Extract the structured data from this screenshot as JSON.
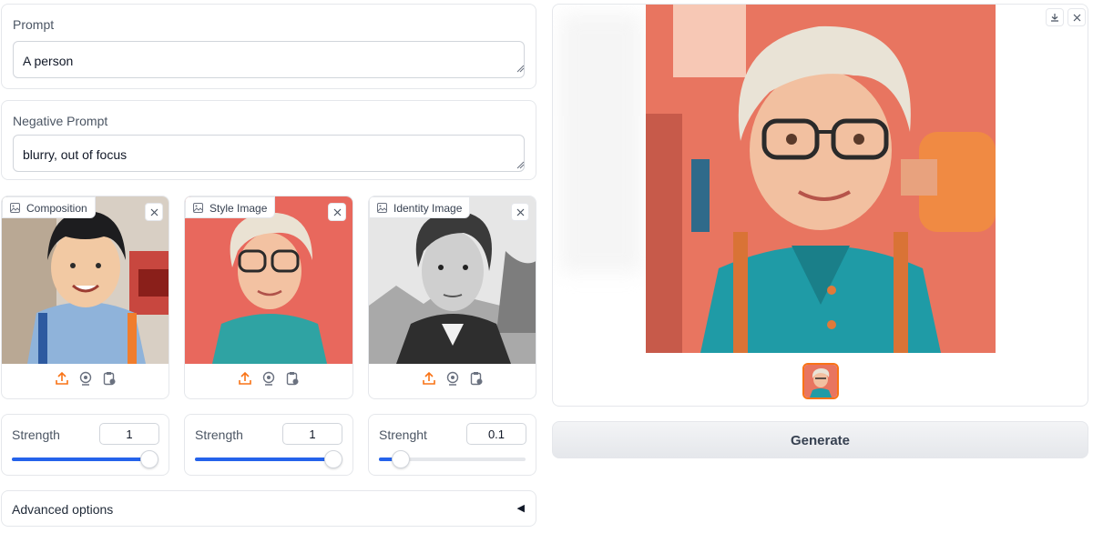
{
  "prompt": {
    "label": "Prompt",
    "value": "A person"
  },
  "negative_prompt": {
    "label": "Negative Prompt",
    "value": "blurry, out of focus"
  },
  "images": [
    {
      "label": "Composition",
      "icon": "image-icon"
    },
    {
      "label": "Style Image",
      "icon": "image-icon"
    },
    {
      "label": "Identity Image",
      "icon": "image-icon"
    }
  ],
  "image_toolbar_icons": [
    "upload-icon",
    "webcam-icon",
    "clipboard-icon"
  ],
  "sliders": [
    {
      "label": "Strength",
      "value": "1",
      "fraction": 1.0
    },
    {
      "label": "Strength",
      "value": "1",
      "fraction": 1.0
    },
    {
      "label": "Strenght",
      "value": "0.1",
      "fraction": 0.1
    }
  ],
  "advanced": {
    "label": "Advanced options",
    "arrow": "◀"
  },
  "generate": {
    "label": "Generate"
  },
  "colors": {
    "accent": "#f97316",
    "slider": "#2563eb",
    "output_bg": "#e87560"
  }
}
